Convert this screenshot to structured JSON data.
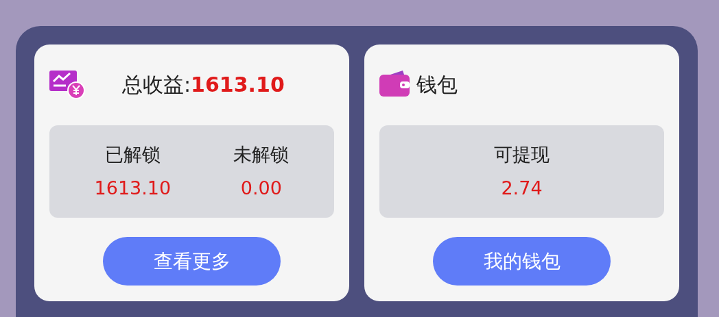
{
  "cards": [
    {
      "kind": "earnings",
      "title": "总收益:",
      "total": "1613.10",
      "stats": [
        {
          "label": "已解锁",
          "value": "1613.10"
        },
        {
          "label": "未解锁",
          "value": "0.00"
        }
      ],
      "button": "查看更多"
    },
    {
      "kind": "wallet",
      "title": "钱包",
      "stats": [
        {
          "label": "可提现",
          "value": "2.74"
        }
      ],
      "button": "我的钱包"
    }
  ]
}
